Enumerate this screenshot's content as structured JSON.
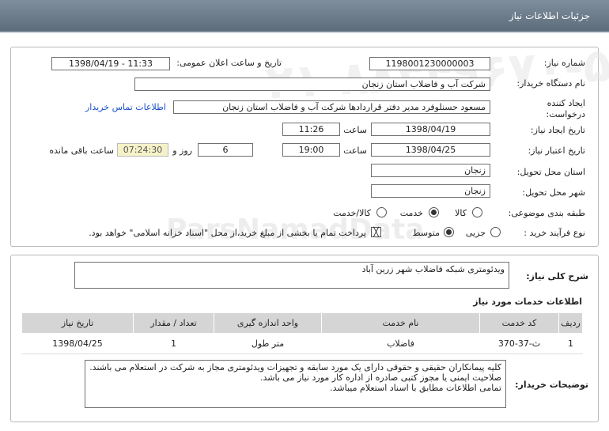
{
  "window": {
    "title": "جزئیات اطلاعات نیاز"
  },
  "watermark": {
    "phone": "۰۲۱-۸۸۳۴۹۶۷۰-۵",
    "site": "ParsNamadData",
    "site_fa": "مرکز فراوری اطلاعات پارس نماد داده ها",
    "line2": "پایگاه اطلاع رسانی مناقصه ومزایده"
  },
  "form": {
    "need_number_label": "شماره نیاز:",
    "need_number": "1198001230000003",
    "announce_label": "تاریخ و ساعت اعلان عمومی:",
    "announce_value": "1398/04/19 - 11:33",
    "buyer_label": "نام دستگاه خریدار:",
    "buyer_value": "شرکت آب و فاضلاب استان زنجان",
    "creator_label": "ایجاد کننده درخواست:",
    "creator_value": "مسعود حسنلوفرد مدیر دفتر قراردادها شرکت آب و فاضلاب استان زنجان",
    "contact_link": "اطلاعات تماس خریدار",
    "create_date_label": "تاریخ ایجاد نیاز:",
    "create_date": "1398/04/19",
    "hour_label": "ساعت",
    "create_time": "11:26",
    "valid_date_label": "تاریخ اعتبار نیاز:",
    "valid_date": "1398/04/25",
    "valid_time": "19:00",
    "days_value": "6",
    "days_label": "روز و",
    "remain_time": "07:24:30",
    "remain_label": "ساعت باقی مانده",
    "province_label": "استان محل تحویل:",
    "province_value": "زنجان",
    "city_label": "شهر محل تحویل:",
    "city_value": "زنجان",
    "category_label": "طبقه بندی موضوعی:",
    "category_options": [
      "کالا",
      "خدمت",
      "کالا/خدمت"
    ],
    "category_selected": "خدمت",
    "process_label": "نوع فرآیند خرید :",
    "process_options": [
      "جزیی",
      "متوسط"
    ],
    "process_selected": "متوسط",
    "payment_note": "پرداخت تمام یا بخشی از مبلغ خرید،از محل \"اسناد خزانه اسلامی\" خواهد بود."
  },
  "summary": {
    "label": "شرح کلی نیاز:",
    "value": "ویدئومتری شبکه فاضلاب شهر زرین آباد"
  },
  "services": {
    "heading": "اطلاعات خدمات مورد نیاز",
    "columns": [
      "ردیف",
      "کد خدمت",
      "نام خدمت",
      "واحد اندازه گیری",
      "تعداد / مقدار",
      "تاریخ نیاز"
    ],
    "rows": [
      [
        "1",
        "ث-37-370",
        "فاضلاب",
        "متر طول",
        "1",
        "1398/04/25"
      ]
    ]
  },
  "buyer_notes": {
    "label": "توضیحات خریدار:",
    "lines": [
      "کلیه پیمانکاران حقیقی و حقوقی دارای یک مورد سابقه و تجهیزات ویدئومتری مجاز به شرکت در استعلام می باشند.",
      "صلاحیت ایمنی یا مجوز کتبی صادره از اداره کار مورد نیاز می باشد.",
      "تمامی اطلاعات مطابق با اسناد استعلام میباشد."
    ]
  }
}
